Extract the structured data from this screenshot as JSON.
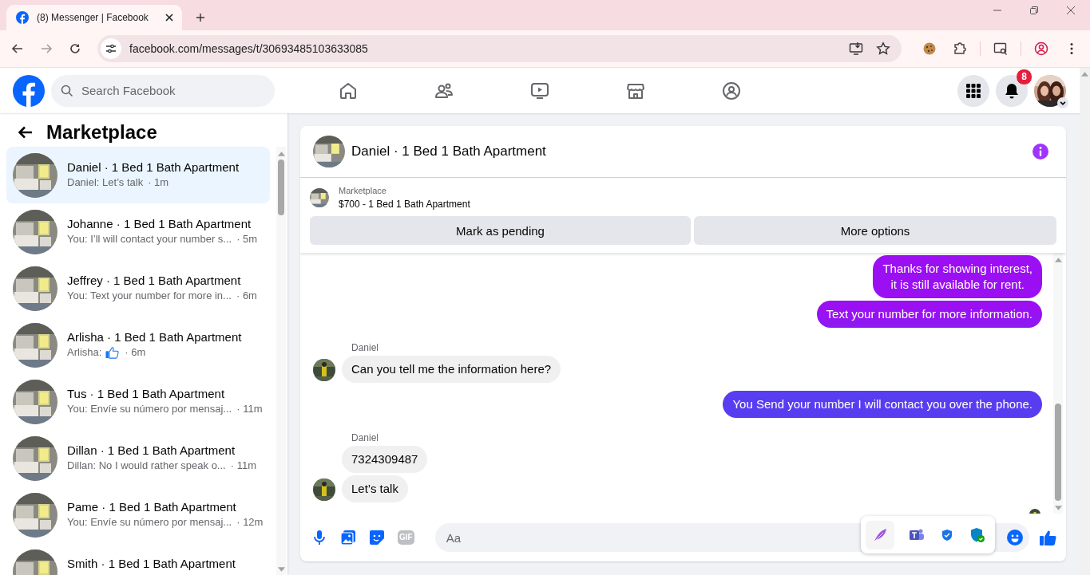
{
  "browser": {
    "tab_title": "(8) Messenger | Facebook",
    "url": "facebook.com/messages/t/30693485103633085"
  },
  "header": {
    "search_placeholder": "Search Facebook",
    "notification_count": "8"
  },
  "sidebar": {
    "title": "Marketplace",
    "conversations": [
      {
        "title": "Daniel · 1 Bed 1 Bath Apartment",
        "kind": "text",
        "preview": "Daniel: Let’s talk",
        "time": "· 1m",
        "selected": true
      },
      {
        "title": "Johanne · 1 Bed 1 Bath Apartment",
        "kind": "text",
        "preview": "You: I’ll will contact your number s...",
        "time": "· 5m",
        "selected": false
      },
      {
        "title": "Jeffrey · 1 Bed 1 Bath Apartment",
        "kind": "text",
        "preview": "You: Text your number for more in...",
        "time": "· 6m",
        "selected": false
      },
      {
        "title": "Arlisha · 1 Bed 1 Bath Apartment",
        "kind": "like",
        "preview": "Arlisha:",
        "time": "· 6m",
        "selected": false
      },
      {
        "title": "Tus · 1 Bed 1 Bath Apartment",
        "kind": "text",
        "preview": "You: Envíe su número por mensaj...",
        "time": "· 11m",
        "selected": false
      },
      {
        "title": "Dillan · 1 Bed 1 Bath Apartment",
        "kind": "text",
        "preview": "Dillan: No I would rather speak o...",
        "time": "· 11m",
        "selected": false
      },
      {
        "title": "Pame · 1 Bed 1 Bath Apartment",
        "kind": "text",
        "preview": "You: Envíe su número por mensaj...",
        "time": "· 12m",
        "selected": false
      },
      {
        "title": "Smith · 1 Bed 1 Bath Apartment",
        "selected": false
      }
    ]
  },
  "chat": {
    "title": "Daniel · 1 Bed 1 Bath Apartment",
    "listing": {
      "label": "Marketplace",
      "name": "$700 - 1 Bed 1 Bath Apartment"
    },
    "actions": [
      "Mark as pending",
      "More options"
    ],
    "messages": [
      {
        "kind": "out",
        "text": "Thanks for showing interest,\nit is still available for rent."
      },
      {
        "kind": "out",
        "text": "Text your number for more information."
      },
      {
        "kind": "sender",
        "text": "Daniel"
      },
      {
        "kind": "in",
        "text": "Can you tell me the information here?",
        "avatar": true
      },
      {
        "kind": "out",
        "text": "You Send your number I will contact you over the phone."
      },
      {
        "kind": "sender",
        "text": "Daniel"
      },
      {
        "kind": "in",
        "text": "7324309487",
        "avatar": false
      },
      {
        "kind": "in",
        "text": "Let’s talk",
        "avatar": true
      }
    ],
    "composer": {
      "placeholder": "Aa",
      "gif_label": "GIF"
    }
  }
}
